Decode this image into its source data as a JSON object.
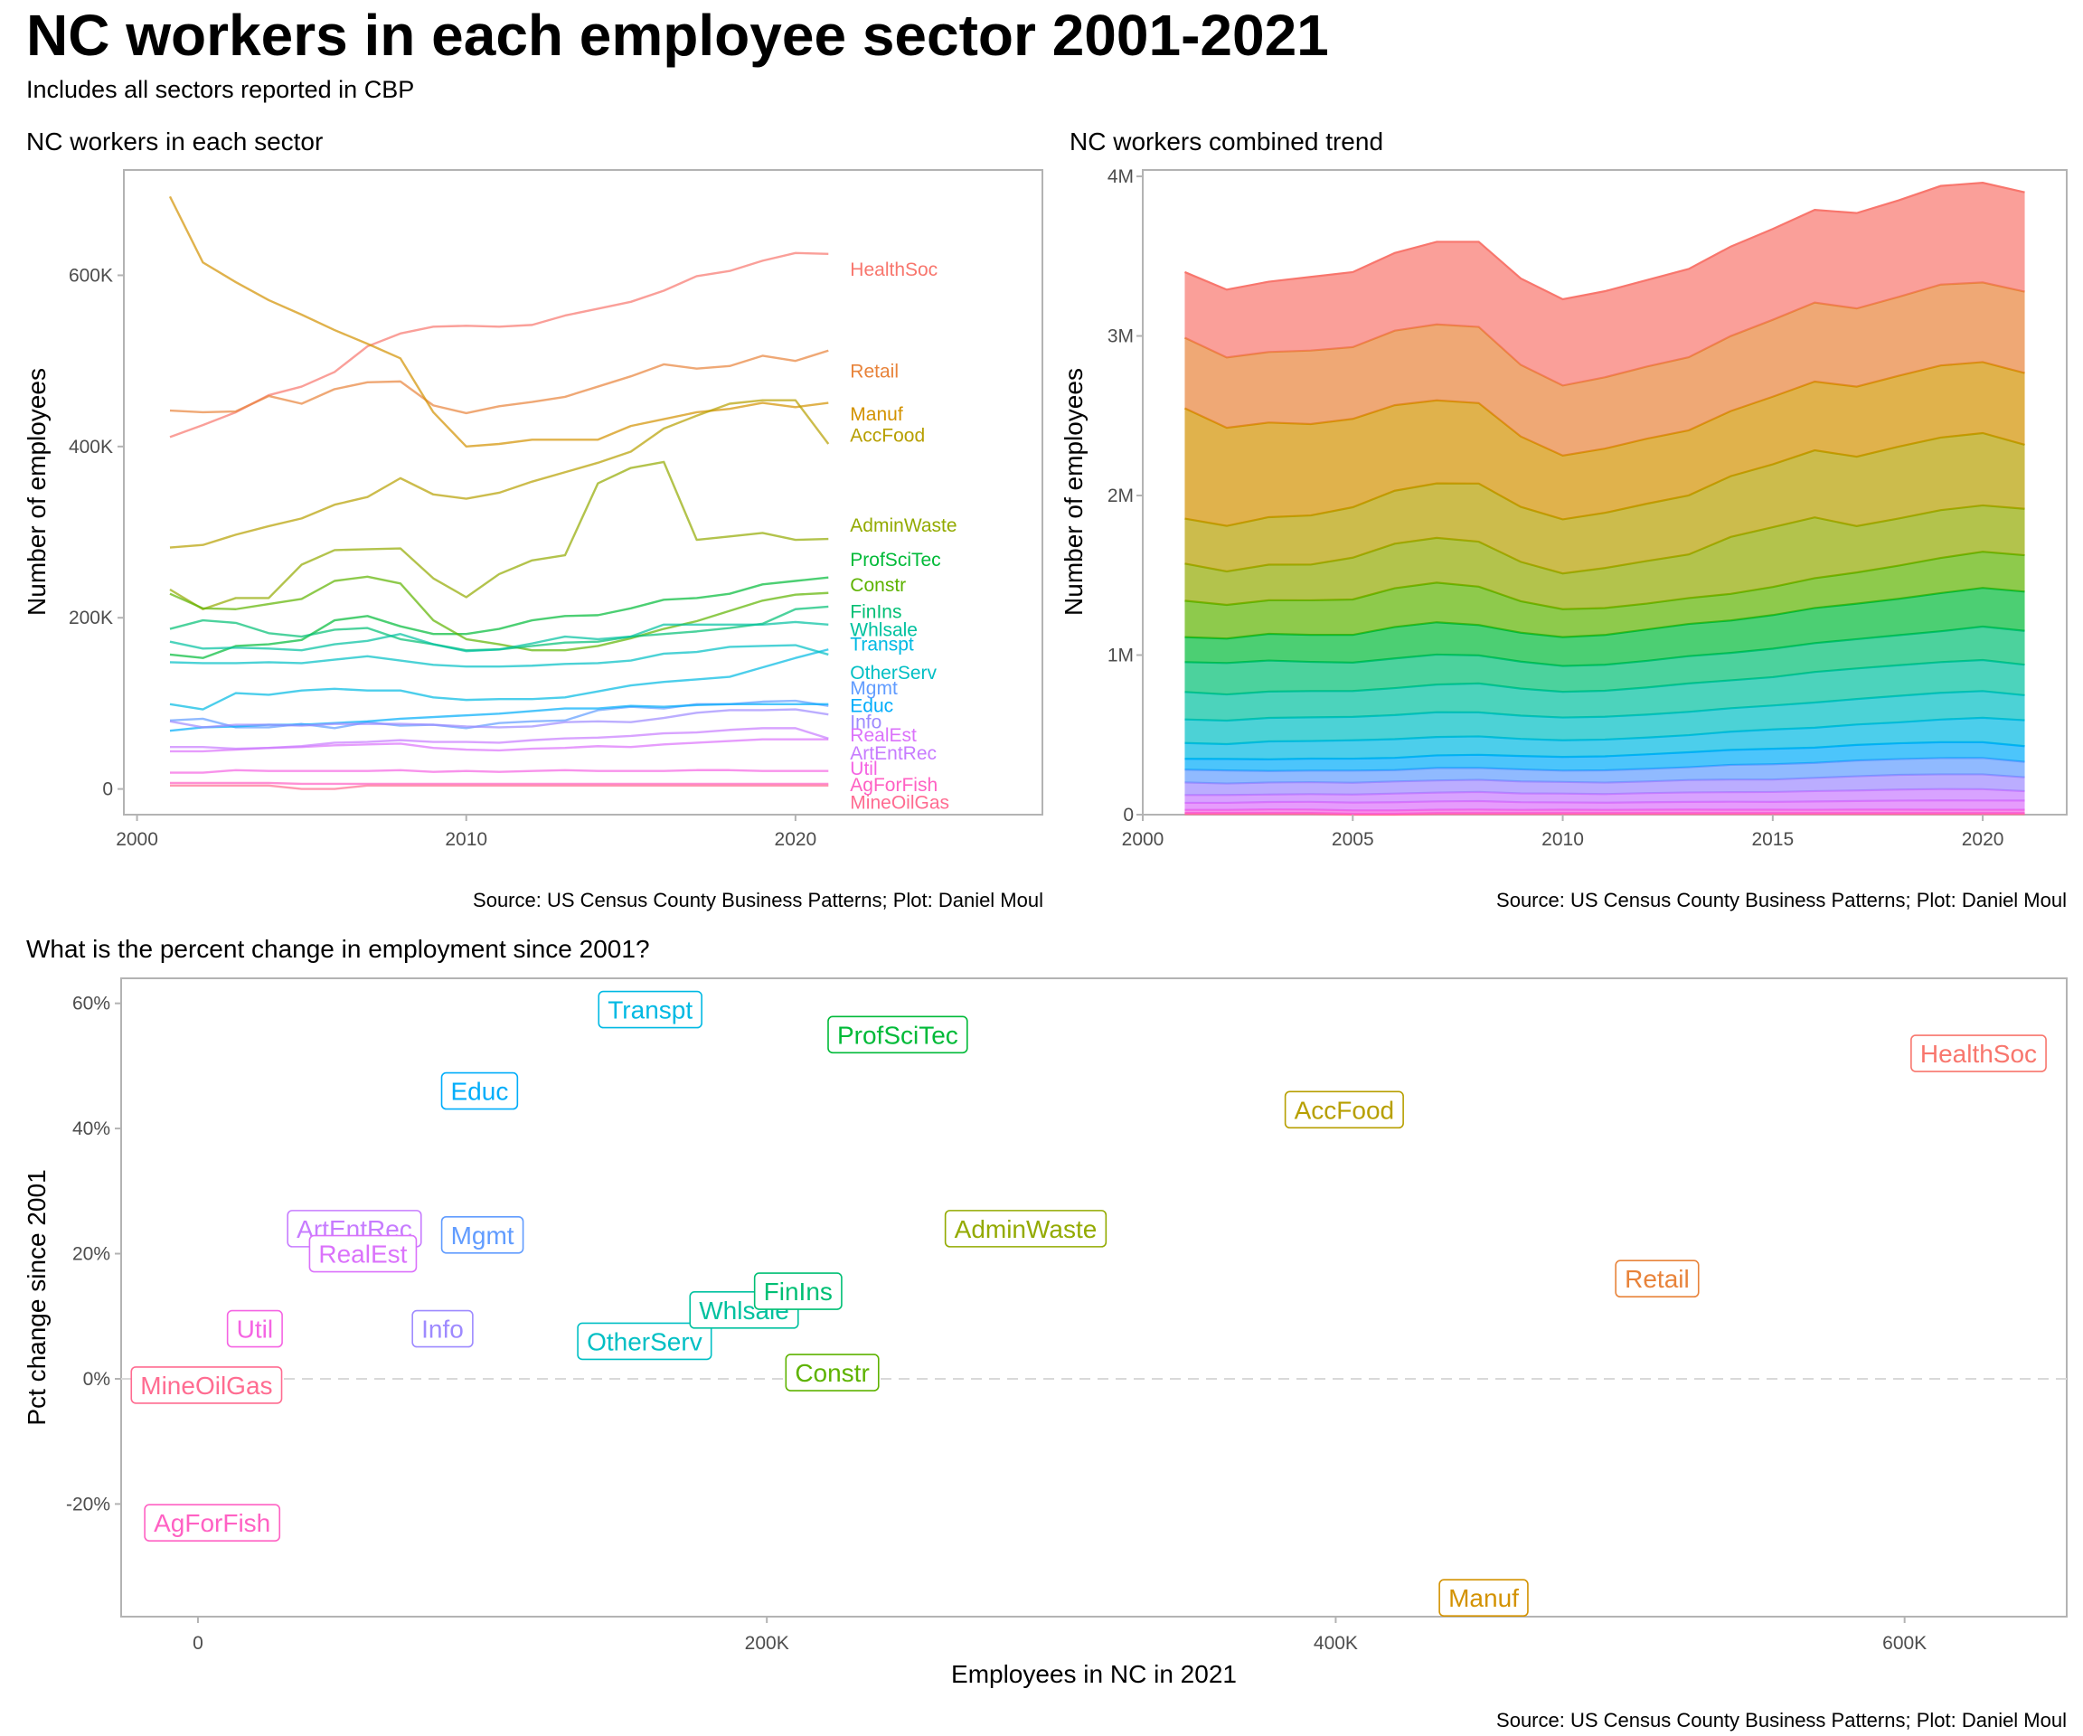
{
  "title": "NC workers in each employee sector 2001-2021",
  "subtitle": "Includes all sectors reported in CBP",
  "caption": "Source: US Census County Business Patterns; Plot: Daniel Moul",
  "sector_colors": {
    "HealthSoc": "#F8766D",
    "Retail": "#E8833A",
    "Manuf": "#D39200",
    "AccFood": "#B79F00",
    "AdminWaste": "#93AA00",
    "Constr": "#5EB300",
    "ProfSciTec": "#00BA38",
    "FinIns": "#00BF74",
    "Whlsale": "#00C19F",
    "OtherServ": "#00BFC4",
    "Transpt": "#00B9E3",
    "Educ": "#00ADFA",
    "Mgmt": "#619CFF",
    "Info": "#9E8AFF",
    "ArtEntRec": "#C77CFF",
    "RealEst": "#DB72FB",
    "Util": "#F564E3",
    "AgForFish": "#FF61C3",
    "MineOilGas": "#FF6C91"
  },
  "chart_data": [
    {
      "type": "line",
      "title": "NC workers in each sector",
      "xlabel": "",
      "ylabel": "Number of employees",
      "xlim": [
        1999.6,
        2027.5
      ],
      "ylim": [
        -30000,
        723000
      ],
      "xticks": [
        2000,
        2010,
        2020
      ],
      "xtick_labels": [
        "2000",
        "2010",
        "2020"
      ],
      "yticks": [
        0,
        200000,
        400000,
        600000
      ],
      "ytick_labels": [
        "0",
        "200K",
        "400K",
        "600K"
      ],
      "grid": false,
      "legend": "direct-labels-right",
      "x": [
        2001,
        2002,
        2003,
        2004,
        2005,
        2006,
        2007,
        2008,
        2009,
        2010,
        2011,
        2012,
        2013,
        2014,
        2015,
        2016,
        2017,
        2018,
        2019,
        2020,
        2021
      ],
      "series": [
        {
          "name": "HealthSoc",
          "label_value": 607000,
          "values": [
            411000,
            425000,
            440000,
            460000,
            470000,
            487000,
            517000,
            532000,
            540000,
            541000,
            540000,
            542000,
            553000,
            561000,
            569000,
            582000,
            599000,
            605000,
            617000,
            626000,
            625000
          ]
        },
        {
          "name": "Retail",
          "label_value": 488000,
          "values": [
            442000,
            440000,
            441000,
            459000,
            450000,
            467000,
            475000,
            476000,
            448000,
            439000,
            447000,
            452000,
            458000,
            470000,
            482000,
            496000,
            491000,
            494000,
            506000,
            500000,
            512000
          ]
        },
        {
          "name": "Manuf",
          "label_value": 438000,
          "values": [
            692000,
            615000,
            592000,
            571000,
            554000,
            536000,
            520000,
            503000,
            440000,
            400000,
            403000,
            408000,
            408000,
            408000,
            424000,
            432000,
            440000,
            444000,
            451000,
            446000,
            451000
          ]
        },
        {
          "name": "AccFood",
          "label_value": 413000,
          "values": [
            282000,
            285000,
            297000,
            307000,
            316000,
            332000,
            341000,
            363000,
            344000,
            339000,
            346000,
            359000,
            370000,
            381000,
            394000,
            421000,
            436000,
            450000,
            454000,
            454000,
            403000
          ]
        },
        {
          "name": "AdminWaste",
          "label_value": 308000,
          "values": [
            233000,
            210000,
            223000,
            223000,
            262000,
            279000,
            280000,
            281000,
            246000,
            224000,
            251000,
            267000,
            273000,
            357000,
            375000,
            382000,
            291000,
            295000,
            299000,
            291000,
            292000
          ]
        },
        {
          "name": "ProfSciTec",
          "label_value": 268000,
          "values": [
            157000,
            153000,
            167000,
            169000,
            174000,
            197000,
            202000,
            190000,
            181000,
            181000,
            187000,
            197000,
            202000,
            203000,
            211000,
            221000,
            223000,
            228000,
            239000,
            243000,
            247000
          ]
        },
        {
          "name": "Constr",
          "label_value": 238000,
          "values": [
            228000,
            211000,
            210000,
            216000,
            222000,
            243000,
            248000,
            240000,
            197000,
            175000,
            169000,
            162000,
            162000,
            167000,
            176000,
            187000,
            196000,
            208000,
            220000,
            227000,
            229000
          ]
        },
        {
          "name": "FinIns",
          "label_value": 207000,
          "values": [
            187000,
            197000,
            194000,
            182000,
            178000,
            186000,
            188000,
            175000,
            169000,
            162000,
            163000,
            167000,
            171000,
            172000,
            178000,
            181000,
            184000,
            188000,
            193000,
            210000,
            213000
          ]
        },
        {
          "name": "Whlsale",
          "label_value": 186000,
          "values": [
            172000,
            164000,
            165000,
            164000,
            162000,
            169000,
            173000,
            181000,
            169000,
            161000,
            163000,
            170000,
            178000,
            175000,
            178000,
            192000,
            192000,
            192000,
            192000,
            195000,
            192000
          ]
        },
        {
          "name": "Transpt",
          "label_value": 169000,
          "values": [
            99000,
            93000,
            112000,
            110000,
            115000,
            117000,
            115000,
            115000,
            107000,
            104000,
            105000,
            105000,
            107000,
            114000,
            121000,
            125000,
            128000,
            131000,
            142000,
            153000,
            163000
          ]
        },
        {
          "name": "OtherServ",
          "label_value": 136000,
          "values": [
            148000,
            147000,
            147000,
            148000,
            147000,
            151000,
            155000,
            150000,
            145000,
            143000,
            143000,
            144000,
            146000,
            147000,
            150000,
            158000,
            160000,
            166000,
            167000,
            168000,
            157000
          ]
        },
        {
          "name": "Mgmt",
          "label_value": 118000,
          "values": [
            80000,
            82000,
            72000,
            72000,
            76000,
            71000,
            78000,
            74000,
            75000,
            71000,
            77000,
            79000,
            80000,
            92000,
            96000,
            94000,
            99000,
            99000,
            102000,
            103000,
            97000
          ]
        },
        {
          "name": "Educ",
          "label_value": 97000,
          "values": [
            68000,
            72000,
            73000,
            75000,
            75000,
            77000,
            79000,
            82000,
            84000,
            86000,
            88000,
            91000,
            94000,
            94000,
            97000,
            96000,
            98000,
            99000,
            99000,
            99000,
            99000
          ]
        },
        {
          "name": "Info",
          "label_value": 78000,
          "values": [
            79000,
            72000,
            75000,
            75000,
            74000,
            76000,
            76000,
            76000,
            75000,
            73000,
            72000,
            73000,
            78000,
            79000,
            78000,
            83000,
            89000,
            92000,
            92000,
            93000,
            87000
          ]
        },
        {
          "name": "RealEst",
          "label_value": 63000,
          "values": [
            44000,
            44000,
            46000,
            48000,
            49000,
            51000,
            52000,
            53000,
            48000,
            46000,
            45000,
            47000,
            48000,
            50000,
            49000,
            52000,
            54000,
            56000,
            58000,
            58000,
            58000
          ]
        },
        {
          "name": "ArtEntRec",
          "label_value": 42000,
          "values": [
            49000,
            49000,
            47000,
            48000,
            50000,
            54000,
            55000,
            57000,
            55000,
            55000,
            54000,
            57000,
            59000,
            60000,
            62000,
            65000,
            66000,
            69000,
            71000,
            71000,
            59000
          ]
        },
        {
          "name": "Util",
          "label_value": 24000,
          "values": [
            19000,
            19000,
            22000,
            21000,
            21000,
            21000,
            21000,
            22000,
            20000,
            21000,
            20000,
            21000,
            22000,
            21000,
            21000,
            21000,
            22000,
            22000,
            21000,
            21000,
            21000
          ]
        },
        {
          "name": "AgForFish",
          "label_value": 5000,
          "values": [
            7000,
            7000,
            7000,
            7000,
            6000,
            6000,
            6000,
            6000,
            6000,
            6000,
            6000,
            6000,
            6000,
            6000,
            6000,
            6000,
            6000,
            6000,
            6000,
            6000,
            6000
          ]
        },
        {
          "name": "MineOilGas",
          "label_value": -16000,
          "values": [
            4000,
            4000,
            4000,
            4000,
            0,
            0,
            4000,
            4000,
            4000,
            4000,
            4000,
            4000,
            4000,
            4000,
            4000,
            4000,
            4000,
            4000,
            4000,
            4000,
            4000
          ]
        }
      ]
    },
    {
      "type": "area",
      "stacked": true,
      "title": "NC workers combined trend",
      "xlabel": "",
      "ylabel": "Number of employees",
      "xlim": [
        2000,
        2022
      ],
      "ylim": [
        0,
        4040000
      ],
      "xticks": [
        2000,
        2005,
        2010,
        2015,
        2020
      ],
      "xtick_labels": [
        "2000",
        "2005",
        "2010",
        "2015",
        "2020"
      ],
      "yticks": [
        0,
        1000000,
        2000000,
        3000000,
        4000000
      ],
      "ytick_labels": [
        "0",
        "1M",
        "2M",
        "3M",
        "4M"
      ],
      "grid": false,
      "stack_order_bottom_to_top": [
        "MineOilGas",
        "AgForFish",
        "Util",
        "RealEst",
        "ArtEntRec",
        "Info",
        "Mgmt",
        "Educ",
        "Transpt",
        "OtherServ",
        "Whlsale",
        "FinIns",
        "ProfSciTec",
        "Constr",
        "AdminWaste",
        "AccFood",
        "Manuf",
        "Retail",
        "HealthSoc"
      ],
      "total_values": [
        3400000,
        3290000,
        3340000,
        3370000,
        3400000,
        3520000,
        3590000,
        3590000,
        3360000,
        3230000,
        3280000,
        3350000,
        3420000,
        3560000,
        3670000,
        3790000,
        3770000,
        3850000,
        3940000,
        3960000,
        3900000
      ],
      "x": [
        2001,
        2002,
        2003,
        2004,
        2005,
        2006,
        2007,
        2008,
        2009,
        2010,
        2011,
        2012,
        2013,
        2014,
        2015,
        2016,
        2017,
        2018,
        2019,
        2020,
        2021
      ]
    },
    {
      "type": "scatter",
      "title": "What is the percent change in employment since 2001?",
      "xlabel": "Employees in NC in 2021",
      "ylabel": "Pct change since 2001",
      "xlim": [
        -27000,
        657000
      ],
      "ylim": [
        -38,
        64
      ],
      "xticks": [
        0,
        200000,
        400000,
        600000
      ],
      "xtick_labels": [
        "0",
        "200K",
        "400K",
        "600K"
      ],
      "yticks": [
        -20,
        0,
        20,
        40,
        60
      ],
      "ytick_labels": [
        "-20%",
        "0%",
        "20%",
        "40%",
        "60%"
      ],
      "reference_line": {
        "y": 0,
        "style": "dashed"
      },
      "grid": false,
      "points": [
        {
          "label": "HealthSoc",
          "x": 626000,
          "y": 52
        },
        {
          "label": "AccFood",
          "x": 403000,
          "y": 43
        },
        {
          "label": "AdminWaste",
          "x": 291000,
          "y": 24
        },
        {
          "label": "Retail",
          "x": 513000,
          "y": 16
        },
        {
          "label": "Manuf",
          "x": 452000,
          "y": -35
        },
        {
          "label": "Transpt",
          "x": 159000,
          "y": 59
        },
        {
          "label": "ProfSciTec",
          "x": 246000,
          "y": 55
        },
        {
          "label": "Educ",
          "x": 99000,
          "y": 46
        },
        {
          "label": "ArtEntRec",
          "x": 55000,
          "y": 24
        },
        {
          "label": "RealEst",
          "x": 58000,
          "y": 20
        },
        {
          "label": "Mgmt",
          "x": 100000,
          "y": 23
        },
        {
          "label": "Util",
          "x": 20000,
          "y": 8
        },
        {
          "label": "Info",
          "x": 86000,
          "y": 8
        },
        {
          "label": "MineOilGas",
          "x": 3000,
          "y": -1
        },
        {
          "label": "AgForFish",
          "x": 5000,
          "y": -23
        },
        {
          "label": "OtherServ",
          "x": 157000,
          "y": 6
        },
        {
          "label": "Whlsale",
          "x": 192000,
          "y": 11
        },
        {
          "label": "FinIns",
          "x": 211000,
          "y": 14
        },
        {
          "label": "Constr",
          "x": 223000,
          "y": 1
        }
      ]
    }
  ]
}
